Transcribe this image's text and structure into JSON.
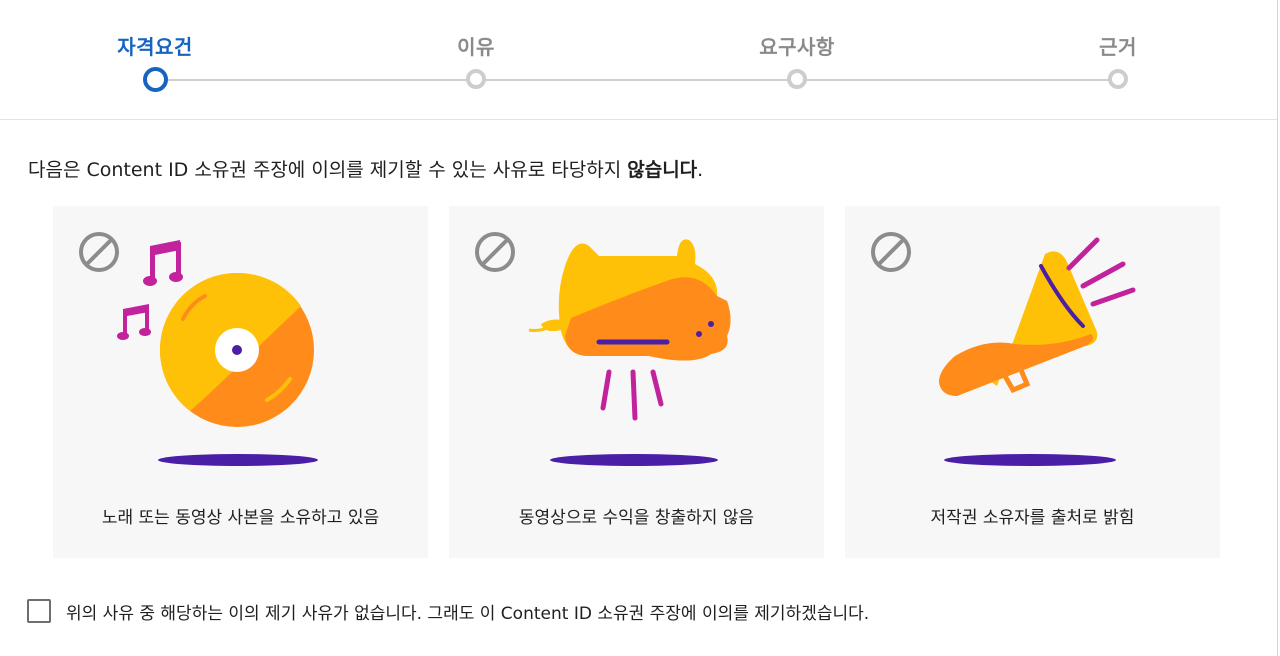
{
  "stepper": {
    "steps": [
      {
        "label": "자격요건",
        "active": true
      },
      {
        "label": "이유",
        "active": false
      },
      {
        "label": "요구사항",
        "active": false
      },
      {
        "label": "근거",
        "active": false
      }
    ]
  },
  "intro": {
    "text": "다음은 Content ID 소유권 주장에 이의를 제기할 수 있는 사유로 타당하지 ",
    "emphasis": "않습니다",
    "end": "."
  },
  "cards": [
    {
      "label": "노래 또는 동영상 사본을 소유하고 있음",
      "icon": "music-disc-icon"
    },
    {
      "label": "동영상으로 수익을 창출하지 않음",
      "icon": "piggy-bank-icon"
    },
    {
      "label": "저작권 소유자를 출처로 밝힘",
      "icon": "megaphone-icon"
    }
  ],
  "confirm": {
    "label": "위의 사유 중 해당하는 이의 제기 사유가 없습니다. 그래도 이 Content ID 소유권 주장에 이의를 제기하겠습니다.",
    "checked": false
  },
  "colors": {
    "accent": "#1565c0",
    "yellow": "#ffc107",
    "orange": "#ff8c1a",
    "magenta": "#c2229c",
    "purple": "#4a1fa6",
    "no_sign": "#8c8c8c"
  }
}
